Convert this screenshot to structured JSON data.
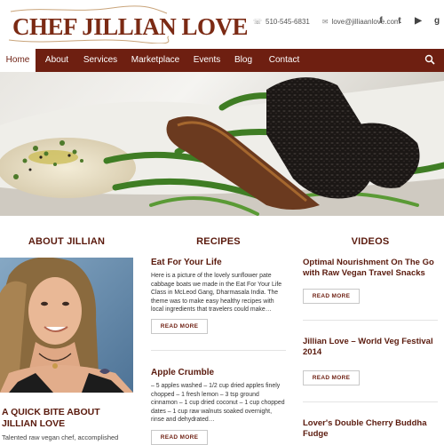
{
  "header": {
    "logo_text": "CHEF JILLIAN LOVE",
    "phone": "510-545-6831",
    "email": "love@jilliaanlove.com",
    "social": [
      {
        "name": "facebook-icon",
        "glyph": "f"
      },
      {
        "name": "twitter-icon",
        "glyph": "t"
      },
      {
        "name": "youtube-icon",
        "glyph": "▶"
      },
      {
        "name": "google-plus-icon",
        "glyph": "g"
      }
    ]
  },
  "nav": {
    "items": [
      {
        "label": "Home",
        "active": true
      },
      {
        "label": "About"
      },
      {
        "label": "Services"
      },
      {
        "label": "Marketplace"
      },
      {
        "label": "Events"
      },
      {
        "label": "Blog"
      },
      {
        "label": "Contact"
      }
    ]
  },
  "sections": {
    "about": {
      "heading": "ABOUT JILLIAN",
      "title": "A QUICK BITE ABOUT JILLIAN LOVE",
      "text": "Talented raw vegan chef, accomplished"
    },
    "recipes": {
      "heading": "RECIPES",
      "items": [
        {
          "title": "Eat For Your Life",
          "text": "Here is a picture of the lovely sunflower pate cabbage boats we made in the Eat For Your Life Class in McLeod Gang, Dharmasala India. The theme was to make easy healthy recipes with local ingredients that travelers could make…",
          "button": "READ MORE"
        },
        {
          "title": "Apple Crumble",
          "text": "– 5 apples washed – 1/2 cup dried apples finely chopped – 1 fresh lemon – 3 tsp ground cinnamon – 1 cup dried coconut – 1 cup chopped dates – 1 cup raw walnuts soaked overnight, rinse and dehydrated…",
          "button": "READ MORE"
        }
      ]
    },
    "videos": {
      "heading": "VIDEOS",
      "items": [
        {
          "title": "Optimal Nourishment On The Go with Raw Vegan Travel Snacks",
          "button": "READ MORE"
        },
        {
          "title": "Jillian Love – World Veg Festival 2014",
          "button": "READ MORE"
        },
        {
          "title": "Lover's Double Cherry Buddha Fudge"
        }
      ]
    }
  },
  "colors": {
    "brand": "#6e1f11",
    "heading": "#5a1a0d"
  }
}
